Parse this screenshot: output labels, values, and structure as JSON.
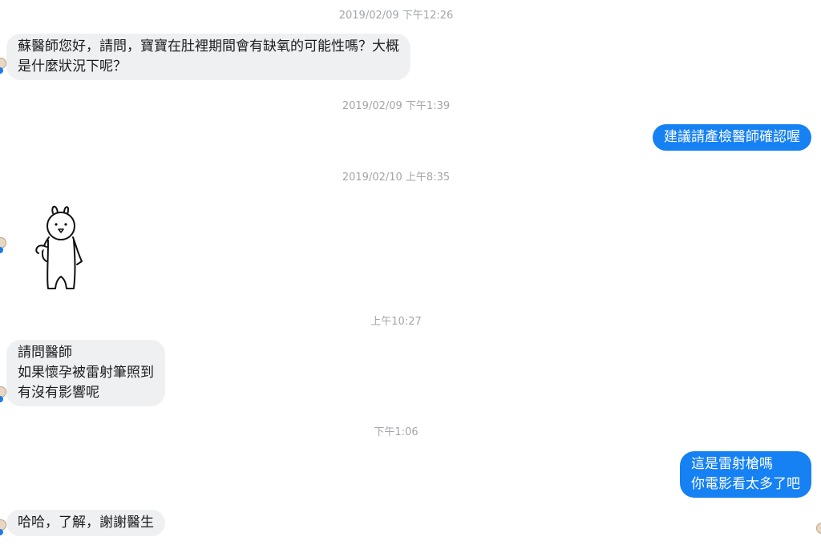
{
  "timestamps": [
    "2019/02/09 下午12:26",
    "2019/02/09 下午1:39",
    "2019/02/10 上午8:35",
    "上午10:27",
    "下午1:06"
  ],
  "messages": [
    {
      "from": "user",
      "lines": [
        "蘇醫師您好，請問，寶寶在肚裡期間會有缺氧的可能性嗎？大概",
        "是什麼狀況下呢？"
      ]
    },
    {
      "from": "doctor",
      "lines": [
        "建議請產檢醫師確認喔"
      ]
    },
    {
      "from": "user",
      "kind": "sticker",
      "sticker": "rabbit-sticker"
    },
    {
      "from": "user",
      "lines": [
        "請問醫師",
        "如果懷孕被雷射筆照到",
        "有沒有影響呢"
      ]
    },
    {
      "from": "doctor",
      "lines": [
        "這是雷射槍嗎",
        "你電影看太多了吧"
      ]
    },
    {
      "from": "user",
      "lines": [
        "哈哈，了解，謝謝醫生"
      ]
    }
  ],
  "colors": {
    "incoming_bubble": "#eff0f2",
    "outgoing_bubble": "#1681f2",
    "timestamp_text": "#a3a5a9"
  }
}
